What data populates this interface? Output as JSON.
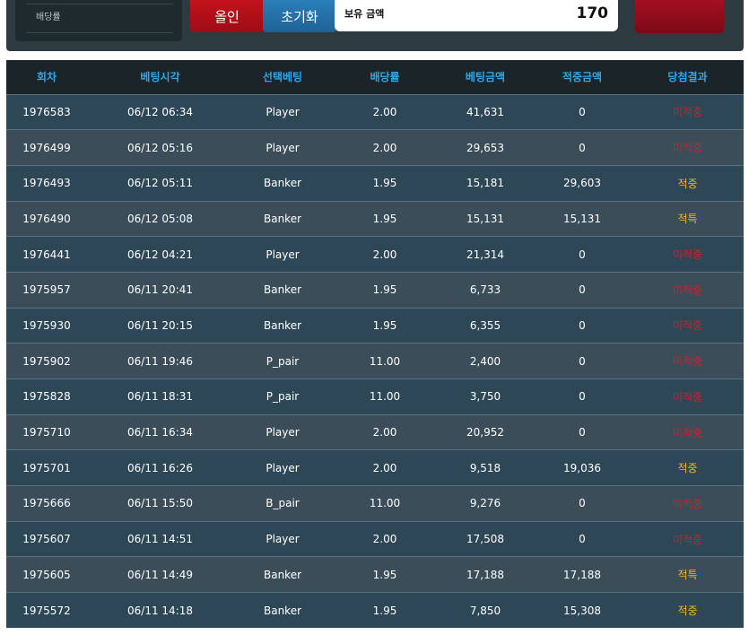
{
  "controls": {
    "odds_label": "배당률",
    "allin_label": "올인",
    "reset_label": "초기화",
    "balance_label": "보유 금액",
    "balance_value": "170"
  },
  "table": {
    "headers": [
      "회차",
      "베팅시각",
      "선택베팅",
      "배당률",
      "베팅금액",
      "적중금액",
      "당첨결과"
    ],
    "rows": [
      {
        "round": "1976583",
        "time": "06/12 06:34",
        "pick": "Player",
        "odds": "2.00",
        "bet": "41,631",
        "payout": "0",
        "result": "미적중",
        "status": "lose"
      },
      {
        "round": "1976499",
        "time": "06/12 05:16",
        "pick": "Player",
        "odds": "2.00",
        "bet": "29,653",
        "payout": "0",
        "result": "미적중",
        "status": "lose"
      },
      {
        "round": "1976493",
        "time": "06/12 05:11",
        "pick": "Banker",
        "odds": "1.95",
        "bet": "15,181",
        "payout": "29,603",
        "result": "적중",
        "status": "win"
      },
      {
        "round": "1976490",
        "time": "06/12 05:08",
        "pick": "Banker",
        "odds": "1.95",
        "bet": "15,131",
        "payout": "15,131",
        "result": "적특",
        "status": "win"
      },
      {
        "round": "1976441",
        "time": "06/12 04:21",
        "pick": "Player",
        "odds": "2.00",
        "bet": "21,314",
        "payout": "0",
        "result": "미적중",
        "status": "lose"
      },
      {
        "round": "1975957",
        "time": "06/11 20:41",
        "pick": "Banker",
        "odds": "1.95",
        "bet": "6,733",
        "payout": "0",
        "result": "미적중",
        "status": "lose"
      },
      {
        "round": "1975930",
        "time": "06/11 20:15",
        "pick": "Banker",
        "odds": "1.95",
        "bet": "6,355",
        "payout": "0",
        "result": "미적중",
        "status": "lose"
      },
      {
        "round": "1975902",
        "time": "06/11 19:46",
        "pick": "P_pair",
        "odds": "11.00",
        "bet": "2,400",
        "payout": "0",
        "result": "미적중",
        "status": "lose"
      },
      {
        "round": "1975828",
        "time": "06/11 18:31",
        "pick": "P_pair",
        "odds": "11.00",
        "bet": "3,750",
        "payout": "0",
        "result": "미적중",
        "status": "lose"
      },
      {
        "round": "1975710",
        "time": "06/11 16:34",
        "pick": "Player",
        "odds": "2.00",
        "bet": "20,952",
        "payout": "0",
        "result": "미적중",
        "status": "lose"
      },
      {
        "round": "1975701",
        "time": "06/11 16:26",
        "pick": "Player",
        "odds": "2.00",
        "bet": "9,518",
        "payout": "19,036",
        "result": "적중",
        "status": "win"
      },
      {
        "round": "1975666",
        "time": "06/11 15:50",
        "pick": "B_pair",
        "odds": "11.00",
        "bet": "9,276",
        "payout": "0",
        "result": "미적중",
        "status": "lose"
      },
      {
        "round": "1975607",
        "time": "06/11 14:51",
        "pick": "Player",
        "odds": "2.00",
        "bet": "17,508",
        "payout": "0",
        "result": "미적중",
        "status": "lose"
      },
      {
        "round": "1975605",
        "time": "06/11 14:49",
        "pick": "Banker",
        "odds": "1.95",
        "bet": "17,188",
        "payout": "17,188",
        "result": "적특",
        "status": "win"
      },
      {
        "round": "1975572",
        "time": "06/11 14:18",
        "pick": "Banker",
        "odds": "1.95",
        "bet": "7,850",
        "payout": "15,308",
        "result": "적중",
        "status": "win"
      }
    ]
  },
  "colors": {
    "header_text": "#2fa7e8",
    "lose": "#d21f2b",
    "win": "#f5b428"
  }
}
